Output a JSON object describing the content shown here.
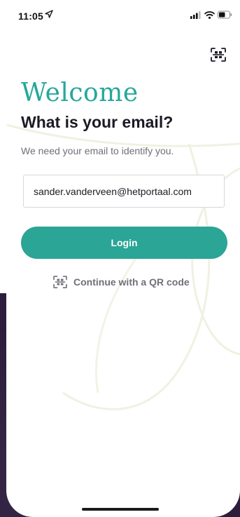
{
  "status_bar": {
    "time": "11:05",
    "location_icon": "location-arrow-icon",
    "signal_icon": "cellular-signal-icon",
    "wifi_icon": "wifi-icon",
    "battery_icon": "battery-icon"
  },
  "header": {
    "qr_icon": "qr-scan-icon"
  },
  "main": {
    "welcome": "Welcome",
    "question": "What is your email?",
    "subtitle": "We need your email to identify you.",
    "email_value": "sander.vanderveen@hetportaal.com",
    "login_label": "Login",
    "qr_link_label": "Continue with a QR code",
    "qr_link_icon": "qr-scan-icon"
  },
  "colors": {
    "accent": "#2aa596",
    "heading": "#1c1a24",
    "muted": "#6f7078",
    "backdrop": "#2c1d3d"
  }
}
